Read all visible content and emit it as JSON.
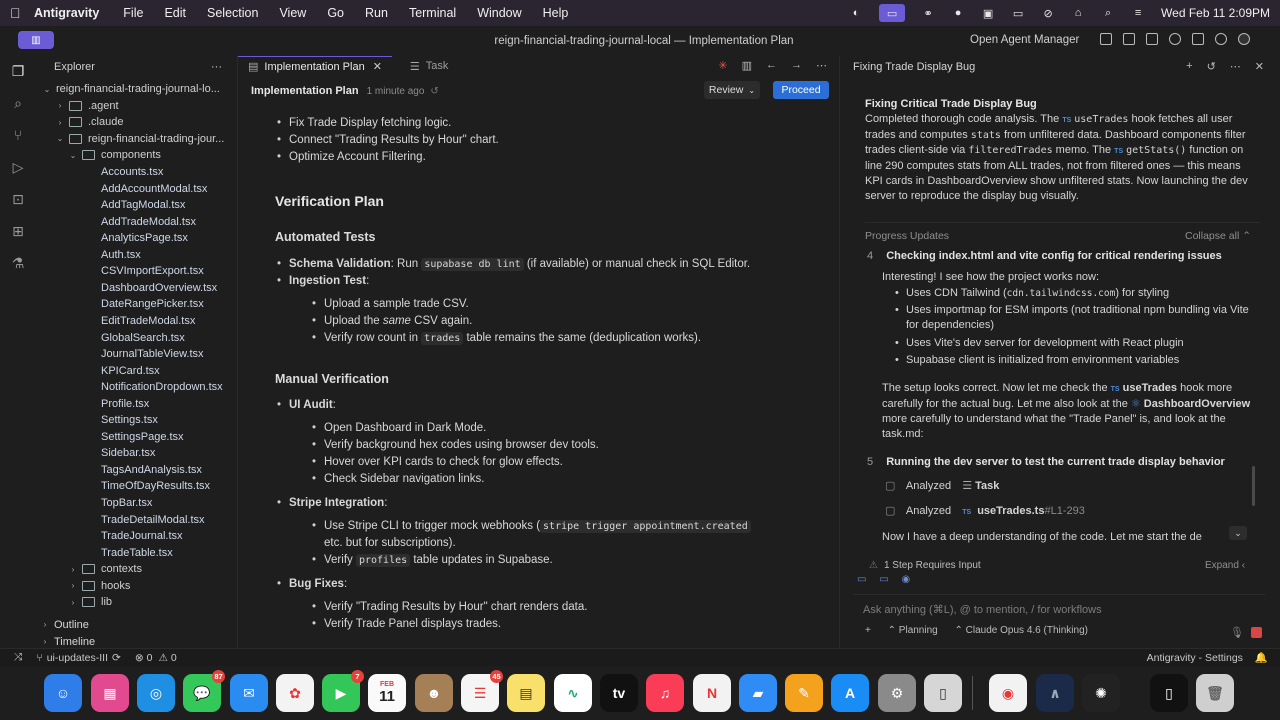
{
  "menubar": {
    "app_name": "Antigravity",
    "menus": [
      "File",
      "Edit",
      "Selection",
      "View",
      "Go",
      "Run",
      "Terminal",
      "Window",
      "Help"
    ],
    "datetime": "Wed Feb 11  2:09PM"
  },
  "titlebar": {
    "title": "reign-financial-trading-journal-local — Implementation Plan",
    "agent_manager": "Open Agent Manager"
  },
  "explorer": {
    "header": "Explorer",
    "more": "···",
    "tree": [
      {
        "label": "reign-financial-trading-journal-lo...",
        "indent": 0,
        "type": "root",
        "chev": "⌄"
      },
      {
        "label": ".agent",
        "indent": 1,
        "type": "folder",
        "chev": "›"
      },
      {
        "label": ".claude",
        "indent": 1,
        "type": "folder",
        "chev": "›"
      },
      {
        "label": "reign-financial-trading-jour...",
        "indent": 1,
        "type": "folder",
        "chev": "⌄"
      },
      {
        "label": "components",
        "indent": 2,
        "type": "folder",
        "chev": "⌄"
      },
      {
        "label": "Accounts.tsx",
        "indent": 3,
        "type": "file"
      },
      {
        "label": "AddAccountModal.tsx",
        "indent": 3,
        "type": "file"
      },
      {
        "label": "AddTagModal.tsx",
        "indent": 3,
        "type": "file"
      },
      {
        "label": "AddTradeModal.tsx",
        "indent": 3,
        "type": "file"
      },
      {
        "label": "AnalyticsPage.tsx",
        "indent": 3,
        "type": "file"
      },
      {
        "label": "Auth.tsx",
        "indent": 3,
        "type": "file"
      },
      {
        "label": "CSVImportExport.tsx",
        "indent": 3,
        "type": "file"
      },
      {
        "label": "DashboardOverview.tsx",
        "indent": 3,
        "type": "file"
      },
      {
        "label": "DateRangePicker.tsx",
        "indent": 3,
        "type": "file"
      },
      {
        "label": "EditTradeModal.tsx",
        "indent": 3,
        "type": "file"
      },
      {
        "label": "GlobalSearch.tsx",
        "indent": 3,
        "type": "file"
      },
      {
        "label": "JournalTableView.tsx",
        "indent": 3,
        "type": "file"
      },
      {
        "label": "KPICard.tsx",
        "indent": 3,
        "type": "file"
      },
      {
        "label": "NotificationDropdown.tsx",
        "indent": 3,
        "type": "file"
      },
      {
        "label": "Profile.tsx",
        "indent": 3,
        "type": "file"
      },
      {
        "label": "Settings.tsx",
        "indent": 3,
        "type": "file"
      },
      {
        "label": "SettingsPage.tsx",
        "indent": 3,
        "type": "file"
      },
      {
        "label": "Sidebar.tsx",
        "indent": 3,
        "type": "file"
      },
      {
        "label": "TagsAndAnalysis.tsx",
        "indent": 3,
        "type": "file"
      },
      {
        "label": "TimeOfDayResults.tsx",
        "indent": 3,
        "type": "file"
      },
      {
        "label": "TopBar.tsx",
        "indent": 3,
        "type": "file"
      },
      {
        "label": "TradeDetailModal.tsx",
        "indent": 3,
        "type": "file"
      },
      {
        "label": "TradeJournal.tsx",
        "indent": 3,
        "type": "file"
      },
      {
        "label": "TradeTable.tsx",
        "indent": 3,
        "type": "file"
      },
      {
        "label": "contexts",
        "indent": 2,
        "type": "folder",
        "chev": "›"
      },
      {
        "label": "hooks",
        "indent": 2,
        "type": "folder",
        "chev": "›"
      },
      {
        "label": "lib",
        "indent": 2,
        "type": "folder",
        "chev": "›"
      }
    ],
    "outline": "Outline",
    "timeline": "Timeline"
  },
  "editor": {
    "tabs": [
      {
        "label": "Implementation Plan",
        "active": true
      },
      {
        "label": "Task",
        "active": false
      }
    ],
    "plan_title": "Implementation Plan",
    "plan_time": "1 minute ago",
    "review": "Review",
    "proceed": "Proceed",
    "doc": {
      "top_bullets": [
        "Fix Trade Display fetching logic.",
        "Connect \"Trading Results by Hour\" chart.",
        "Optimize Account Filtering."
      ],
      "verification_plan": "Verification Plan",
      "automated_tests": "Automated Tests",
      "schema_label": "Schema Validation",
      "schema_pre": ": Run ",
      "schema_code": "supabase db lint",
      "schema_post": " (if available) or manual check in SQL Editor.",
      "ingestion_label": "Ingestion Test",
      "ingestion_items": [
        "Upload a sample trade CSV."
      ],
      "ingestion_same_pre": "Upload the ",
      "ingestion_same_em": "same",
      "ingestion_same_post": " CSV again.",
      "verify_row_pre": "Verify row count in ",
      "verify_row_code": "trades",
      "verify_row_post": " table remains the same (deduplication works).",
      "manual_verification": "Manual Verification",
      "ui_audit_label": "UI Audit",
      "ui_audit_items": [
        "Open Dashboard in Dark Mode.",
        "Verify background hex codes using browser dev tools.",
        "Hover over KPI cards to check for glow effects.",
        "Check Sidebar navigation links."
      ],
      "stripe_label": "Stripe Integration",
      "stripe_pre": "Use Stripe CLI to trigger mock webhooks (",
      "stripe_code": "stripe trigger appointment.created",
      "stripe_post": "etc. but for subscriptions).",
      "profiles_pre": "Verify ",
      "profiles_code": "profiles",
      "profiles_post": " table updates in Supabase.",
      "bug_label": "Bug Fixes",
      "bug_items": [
        "Verify \"Trading Results by Hour\" chart renders data.",
        "Verify Trade Panel displays trades."
      ]
    }
  },
  "agent": {
    "header": "Fixing Trade Display Bug",
    "summary_title": "Fixing Critical Trade Display Bug",
    "summary": {
      "p1": "Completed thorough code analysis. The ",
      "p1_ts": "TS",
      "p1_hook": "useTrades",
      "p2": " hook fetches all user trades and computes ",
      "p2_code": "stats",
      "p3": " from unfiltered data. Dashboard components filter trades client-side via ",
      "p3_code": "filteredTrades",
      "p4": " memo. The ",
      "p4_fn": "getStats()",
      "p5": " function on line 290 computes stats from ALL trades, not from filtered ones — this means KPI cards in DashboardOverview show unfiltered stats. Now launching the dev server to reproduce the display bug visually."
    },
    "progress_label": "Progress Updates",
    "collapse_all": "Collapse all",
    "step4_num": "4",
    "step4_title": "Checking index.html and vite config for critical rendering issues",
    "step4_intro": "Interesting! I see how the project works now:",
    "step4_b1_pre": "Uses CDN Tailwind (",
    "step4_b1_code": "cdn.tailwindcss.com",
    "step4_b1_post": ") for styling",
    "step4_b2": "Uses importmap for ESM imports (not traditional npm bundling via Vite for dependencies)",
    "step4_b3": "Uses Vite's dev server for development with React plugin",
    "step4_b4": "Supabase client is initialized from environment variables",
    "step4_para1": "The setup looks correct. Now let me check the ",
    "step4_para_hook": "useTrades",
    "step4_para2": " hook more carefully for the actual bug. Let me also look at the ",
    "step4_para_comp": "DashboardOverview",
    "step4_para3": " more carefully to understand what the \"Trade Panel\" is, and look at the task.md:",
    "step5_num": "5",
    "step5_title": "Running the dev server to test the current trade display behavior",
    "analyzed_1_label": "Analyzed",
    "analyzed_1_target": "Task",
    "analyzed_2_label": "Analyzed",
    "analyzed_2_target": "useTrades.ts",
    "analyzed_2_range": "#L1-293",
    "deep_text": "Now I have a deep understanding of the code. Let me start the de",
    "requires_input": "1 Step Requires Input",
    "expand": "Expand",
    "input_placeholder": "Ask anything (⌘L), @ to mention, / for workflows",
    "mode": "Planning",
    "model": "Claude Opus 4.6 (Thinking)"
  },
  "statusbar": {
    "branch": "ui-updates-III",
    "errors": "0",
    "warnings": "0",
    "settings": "Antigravity - Settings"
  },
  "dock": {
    "badges": {
      "appstore": "87",
      "messages": "7",
      "mail": "45"
    },
    "calendar_month": "FEB",
    "calendar_day": "11",
    "tv_label": "tv"
  }
}
